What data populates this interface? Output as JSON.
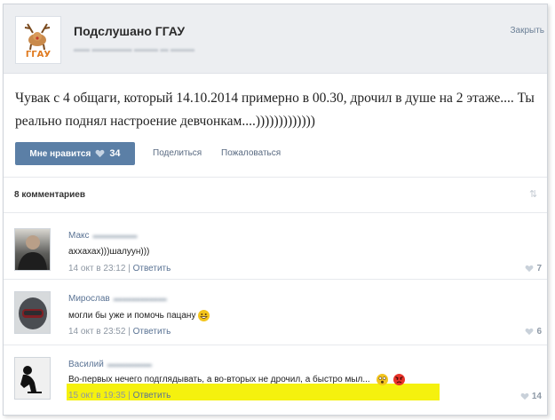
{
  "header": {
    "group_name": "Подслушано ГГАУ",
    "logo_text": "ГГАУ",
    "close_label": "Закрыть"
  },
  "post": {
    "text": "Чувак с 4 общаги, который 14.10.2014 примерно в 00.30, дрочил в душе на 2 этаже.... Ты реально поднял настроение девчонкам....)))))))))))))"
  },
  "actions": {
    "like_label": "Мне нравится",
    "like_count": "34",
    "share_label": "Поделиться",
    "report_label": "Пожаловаться"
  },
  "comments_header": {
    "count_label": "8 комментариев"
  },
  "comments": [
    {
      "author": "Макс",
      "text": "аххахах)))шалуун)))",
      "date": "14 окт в 23:12",
      "reply_label": "Ответить",
      "likes": "7"
    },
    {
      "author": "Мирослав",
      "text": "могли бы уже и помочь пацану",
      "date": "14 окт в 23:52",
      "reply_label": "Ответить",
      "likes": "6"
    },
    {
      "author": "Василий",
      "text": "Во-первых нечего подглядывать, а во-вторых не дрочил, а быстро мыл...",
      "date": "15 окт в 19:35",
      "reply_label": "Ответить",
      "likes": "14"
    }
  ],
  "colors": {
    "like_button": "#5b7fa6",
    "highlight": "#f5f10e",
    "link": "#5a7394"
  }
}
